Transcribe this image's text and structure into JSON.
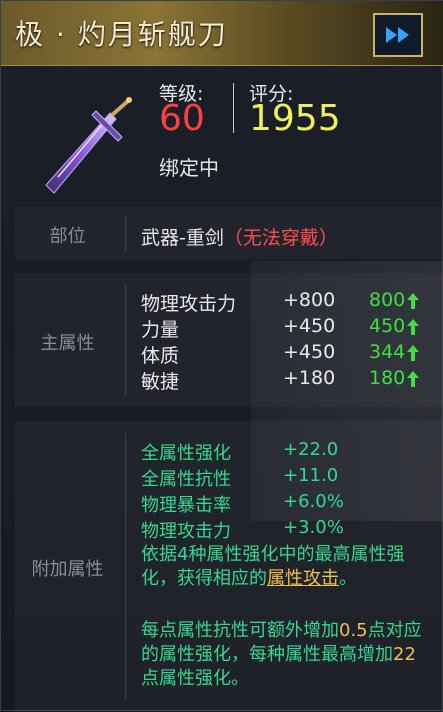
{
  "header": {
    "title": "极 · 灼月斩舰刀",
    "ff_icon": "fast-forward-icon"
  },
  "stats": {
    "level_label": "等级:",
    "level_value": "60",
    "score_label": "评分:",
    "score_value": "1955",
    "bind_status": "绑定中"
  },
  "part": {
    "label": "部位",
    "value": "武器-重剑",
    "warning": "（无法穿戴）"
  },
  "main_attrs": {
    "label": "主属性",
    "rows": [
      {
        "name": "物理攻击力",
        "base": "+800",
        "current": "800"
      },
      {
        "name": "力量",
        "base": "+450",
        "current": "450"
      },
      {
        "name": "体质",
        "base": "+450",
        "current": "344"
      },
      {
        "name": "敏捷",
        "base": "+180",
        "current": "180"
      }
    ]
  },
  "extra_attrs": {
    "label": "附加属性",
    "rows": [
      {
        "name": "全属性强化",
        "value": "+22.0"
      },
      {
        "name": "全属性抗性",
        "value": "+11.0"
      },
      {
        "name": "物理暴击率",
        "value": "+6.0%"
      },
      {
        "name": "物理攻击力",
        "value": "+3.0%"
      }
    ],
    "desc1_a": "依据4种属性强化中的最高属性强化，获得相应的",
    "desc1_hl": "属性攻击",
    "desc1_b": "。",
    "desc2_a": "每点属性抗性可额外增加",
    "desc2_num1": "0.5",
    "desc2_b": "点对应的属性强化，每种属性最高增加",
    "desc2_num2": "22",
    "desc2_c": "点属性强化。"
  },
  "colors": {
    "level": "#ff4040",
    "score": "#f0ef5a",
    "warning": "#ff4d4d",
    "up": "#3fe03f",
    "extra": "#35d890",
    "highlight": "#f0c050"
  }
}
